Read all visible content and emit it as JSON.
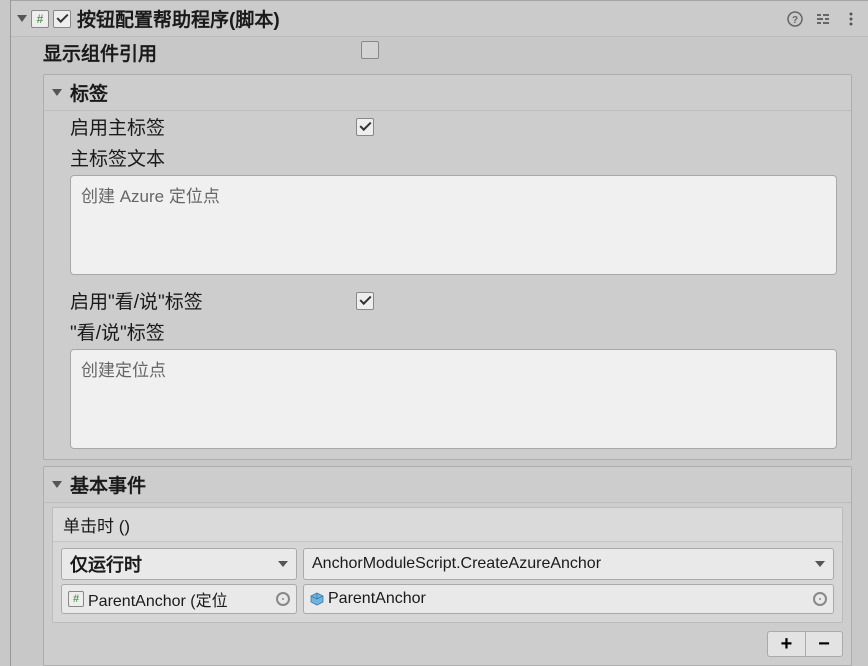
{
  "component": {
    "title": "按钮配置帮助程序(脚本)",
    "enabled": true,
    "show_refs_label": "显示组件引用",
    "show_refs_checked": false,
    "labels_section": {
      "title": "标签",
      "enable_main_label": "启用主标签",
      "enable_main_checked": true,
      "main_label_text": "主标签文本",
      "main_label_value": "创建 Azure 定位点",
      "enable_seesay_label": "启用\"看/说\"标签",
      "enable_seesay_checked": true,
      "seesay_label": "\"看/说\"标签",
      "seesay_value": "创建定位点"
    },
    "events_section": {
      "title": "基本事件",
      "onclick_label": "单击时 ()",
      "runtime_mode": "仅运行时",
      "function": "AnchorModuleScript.CreateAzureAnchor",
      "target_script": "ParentAnchor (定位",
      "target_object": "ParentAnchor"
    }
  }
}
